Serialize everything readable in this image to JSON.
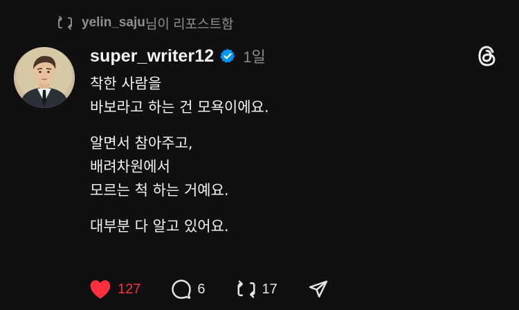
{
  "repost": {
    "icon": "repost-icon",
    "username": "yelin_saju",
    "suffix": "님이 리포스트함"
  },
  "post": {
    "author": {
      "username": "super_writer12",
      "verified": true,
      "avatar_icon": "avatar"
    },
    "time": "1일",
    "paragraphs": [
      [
        "착한 사람을",
        "바보라고 하는 건 모욕이에요."
      ],
      [
        "알면서 참아주고,",
        "배려차원에서",
        "모르는 척 하는 거예요."
      ],
      [
        "대부분 다 알고 있어요."
      ]
    ],
    "actions": {
      "likes": "127",
      "comments": "6",
      "reposts": "17"
    }
  },
  "colors": {
    "background": "#101010",
    "text": "#f3f5f7",
    "muted": "#8b8b8b",
    "like": "#ff3040",
    "verified": "#0095f6"
  },
  "icons": [
    "repost-icon",
    "verified-icon",
    "threads-logo-icon",
    "heart-icon",
    "comment-icon",
    "share-icon"
  ]
}
